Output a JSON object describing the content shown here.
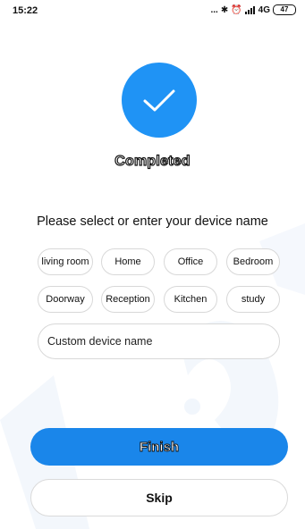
{
  "status_bar": {
    "time": "15:22",
    "signal_text": "...",
    "network": "4G",
    "battery": "47"
  },
  "status": {
    "title": "Completed"
  },
  "prompt": "Please select or enter your device name",
  "device_names": [
    "living room",
    "Home",
    "Office",
    "Bedroom",
    "Doorway",
    "Reception",
    "Kitchen",
    "study"
  ],
  "custom_input": {
    "placeholder": "Custom device name"
  },
  "buttons": {
    "finish": "Finish",
    "skip": "Skip"
  },
  "colors": {
    "accent": "#1f93f5",
    "button": "#1a86ea"
  }
}
